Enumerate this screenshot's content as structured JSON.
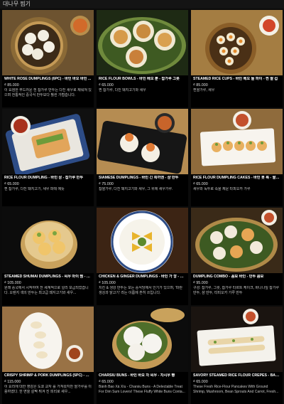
{
  "header": {
    "title": "대나무 찜기"
  },
  "colors": {
    "background": "#0b0b0b",
    "card": "#000000",
    "text": "#ffffff",
    "bamboo": "#c9a25c"
  },
  "items": [
    {
      "name": "WHITE ROSE DUMPLINGS (6PC) - 바인 바오 바인 ...",
      "price": "₫ 85.000",
      "desc": "이 요염한 부드러운 흰 찹가루 만두는 다진 새우로 채워져 있으며 전통적인 중국식 만두보다 훨씬 가볍습니다."
    },
    {
      "name": "RICE FLOUR BOWLS - 바인 베오 뿐 - 찹가루 그릇",
      "price": "₫ 65.000",
      "desc": "찐 찹가루, 다진 돼지고기와 새우"
    },
    {
      "name": "STEAMED RICE CUPS - 바인 베오 돌 파이 - 찐 쌀 컵",
      "price": "₫ 85.000",
      "desc": "찐쌀가루, 새우"
    },
    {
      "name": "RICE FLOUR DUMPLING - 바인 삼 - 찹가루 만두",
      "price": "₫ 65.000",
      "desc": "찐 찹가루, 다진 돼지고기, 새우 파테 에뜻"
    },
    {
      "name": "SIAMESE DUMPLINGS - 바인 긴 쪽끼엔 - 샴 만두",
      "price": "₫ 75.000",
      "desc": "찹쌀가루, 다진 돼지고기와 새우, 그 위에 새우가루."
    },
    {
      "name": "RICE FLOUR DUMPLING CAKES - 바인 봇 록 - 쌀 만두 케이크",
      "price": "₫ 65.000",
      "desc": "새우와 녹두로 속을 채운 타피오카 가루"
    },
    {
      "name": "STEAMED SHUMAI DUMPLINGS - 씨우 마이 찜 - 찐...",
      "price": "₫ 105.000",
      "desc": "원래 중국에서 시작하여 전 세계적으로 널리 보급되었습니다. 오렌지 색의 만두는 최고급 돼지고기와 새우..."
    },
    {
      "name": "CHICKEN & GINGER DUMPLINGS - 바인 가 깡 - 닭...",
      "price": "₫ 105.000",
      "desc": "치킨 & 생강 만두는 모든 중식당에서 인기가 있으며, '파란 생강과 닭고기' 라는 이름에 흔히 쓰입니다."
    },
    {
      "name": "DUMPLING COMBO - 꼼보 바인 - 만두 콤보",
      "price": "₫ 95.000",
      "desc": "구성: 찹가루, 그릇, 찹가루 타르트 케이크, 바나나잎 찹가루 만두, 샴 만두, 타피오카 가루 만두"
    },
    {
      "name": "CRISPY SHRIMP & PORK DUMPLINGS (5PC) - 바인...",
      "price": "₫ 115.000",
      "desc": "이 요리에 대한 영감은 도쿄 교자 를 가져왔지만 쌀가루를 이용하였다. 한 면을 살짝 튀겨 진 피리로 새우..."
    },
    {
      "name": "CHARSIU BUNS - 바인 바오 차 씨우 - 차시우 빵",
      "price": "₫ 65.000",
      "desc": "Bánh Bao Xá Xíu - Charsiu Buns - A Delectable Treat For Dim Sum Lovers! These Fluffy White Buns Conta..."
    },
    {
      "name": "SAVORY STEAMED RICE FLOUR CREPES - BÁNH...",
      "price": "₫ 65.000",
      "desc": "These Fresh Rice-Flour Pancakes With Ground Shrimp, Mushroom, Bean Sprouts And Carrot, Fresh..."
    }
  ]
}
